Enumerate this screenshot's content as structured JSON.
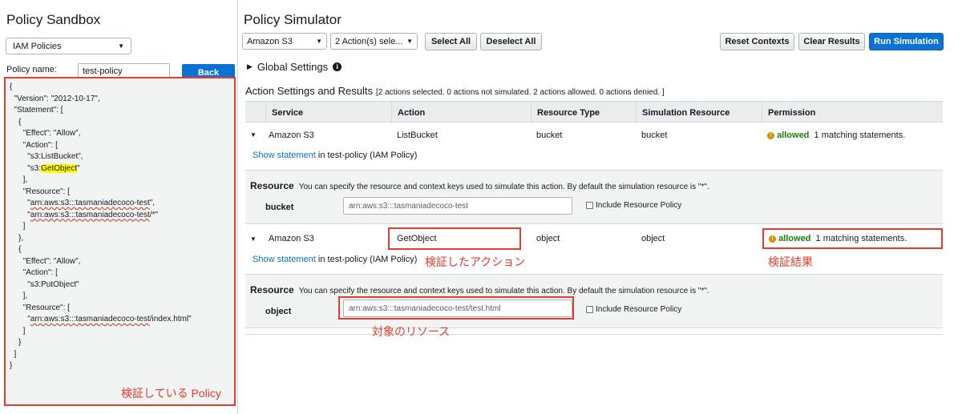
{
  "sandbox": {
    "title": "Policy Sandbox",
    "policy_type": "IAM Policies",
    "policy_name_label": "Policy name:",
    "policy_name_value": "test-policy",
    "back_label": "Back",
    "code": {
      "l1": "{",
      "l2": "  \"Version\": \"2012-10-17\",",
      "l3": "  \"Statement\": [",
      "l4": "    {",
      "l5": "      \"Effect\": \"Allow\",",
      "l6": "      \"Action\": [",
      "l7": "        \"s3:ListBucket\",",
      "l8_pre": "        \"s3:",
      "l8_hl": "GetObject",
      "l8_post": "\"",
      "l9": "      ],",
      "l10": "      \"Resource\": [",
      "l11_pre": "        \"",
      "l11_arn": "arn:aws:s3:::tasmaniadecoco-test",
      "l11_post": "\",",
      "l12_pre": "        \"",
      "l12_arn": "arn:aws:s3:::tasmaniadecoco-test",
      "l12_post": "/*\"",
      "l13": "      ]",
      "l14": "    },",
      "l15": "    {",
      "l16": "      \"Effect\": \"Allow\",",
      "l17": "      \"Action\": [",
      "l18": "        \"s3:PutObject\"",
      "l19": "      ],",
      "l20": "      \"Resource\": [",
      "l21_pre": "        \"",
      "l21_arn": "arn:aws:s3:::tasmaniadecoco-test",
      "l21_post": "/index.html\"",
      "l22": "      ]",
      "l23": "    }",
      "l24": "  ]",
      "l25": "}"
    },
    "annotation": "検証している Policy"
  },
  "simulator": {
    "title": "Policy Simulator",
    "service_select": "Amazon S3",
    "actions_select": "2 Action(s) sele...",
    "select_all": "Select All",
    "deselect_all": "Deselect All",
    "reset_contexts": "Reset Contexts",
    "clear_results": "Clear Results",
    "run_simulation": "Run Simulation",
    "global_settings": "Global Settings",
    "action_settings_title": "Action Settings and Results",
    "action_settings_summary": "[2 actions selected. 0 actions not simulated. 2 actions allowed. 0 actions denied. ]",
    "columns": [
      "Service",
      "Action",
      "Resource Type",
      "Simulation Resource",
      "Permission"
    ],
    "rows": [
      {
        "service": "Amazon S3",
        "action": "ListBucket",
        "resource_type": "bucket",
        "simulation_resource": "bucket",
        "permission": "allowed",
        "matching": "1 matching statements.",
        "show_statement": "Show statement",
        "statement_source": " in test-policy (IAM Policy)"
      },
      {
        "service": "Amazon S3",
        "action": "GetObject",
        "resource_type": "object",
        "simulation_resource": "object",
        "permission": "allowed",
        "matching": "1 matching statements.",
        "show_statement": "Show statement",
        "statement_source": " in test-policy (IAM Policy)"
      }
    ],
    "resources": [
      {
        "heading": "Resource",
        "description": "You can specify the resource and context keys used to simulate this action. By default the simulation resource is \"*\".",
        "label": "bucket",
        "value": "arn:aws:s3:::tasmaniadecoco-test",
        "include_label": "Include Resource Policy"
      },
      {
        "heading": "Resource",
        "description": "You can specify the resource and context keys used to simulate this action. By default the simulation resource is \"*\".",
        "label": "object",
        "value": "arn:aws:s3:::tasmaniadecoco-test/test.html",
        "include_label": "Include Resource Policy"
      }
    ],
    "annotations": {
      "action": "検証したアクション",
      "result": "検証結果",
      "resource": "対象のリソース"
    }
  },
  "colors": {
    "primary": "#0972d3",
    "allowed": "#1d8102",
    "annotation": "#e53c2e",
    "highlight": "#ffff00"
  }
}
